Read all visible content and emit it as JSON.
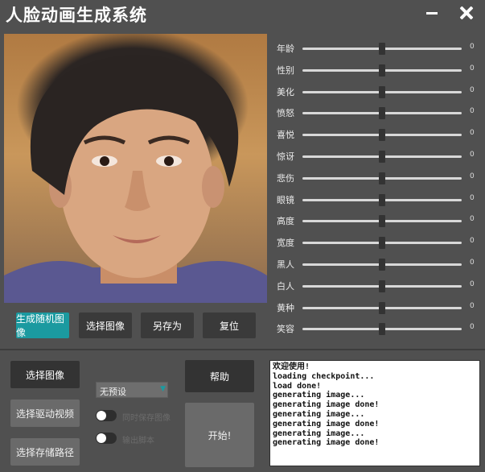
{
  "window": {
    "title": "人脸动画生成系统",
    "minimize_icon": "minimize-icon",
    "close_icon": "close-icon"
  },
  "preview": {
    "image": "generated-face-photo"
  },
  "buttons_row": {
    "random": "生成随机图像",
    "select_image": "选择图像",
    "save_as": "另存为",
    "reset": "复位"
  },
  "sliders": [
    {
      "label": "年龄",
      "value": "0",
      "level": 0.5
    },
    {
      "label": "性别",
      "value": "0",
      "level": 0.5
    },
    {
      "label": "美化",
      "value": "0",
      "level": 0.5
    },
    {
      "label": "愤怒",
      "value": "0",
      "level": 0.5
    },
    {
      "label": "喜悦",
      "value": "0",
      "level": 0.5
    },
    {
      "label": "惊讶",
      "value": "0",
      "level": 0.5
    },
    {
      "label": "悲伤",
      "value": "0",
      "level": 0.5
    },
    {
      "label": "眼镜",
      "value": "0",
      "level": 0.5
    },
    {
      "label": "高度",
      "value": "0",
      "level": 0.5
    },
    {
      "label": "宽度",
      "value": "0",
      "level": 0.5
    },
    {
      "label": "黑人",
      "value": "0",
      "level": 0.5
    },
    {
      "label": "白人",
      "value": "0",
      "level": 0.5
    },
    {
      "label": "黄种",
      "value": "0",
      "level": 0.5
    },
    {
      "label": "笑容",
      "value": "0",
      "level": 0.5
    }
  ],
  "bottom": {
    "select_image": "选择图像",
    "select_driving_video": "选择驱动视频",
    "select_save_path": "选择存储路径",
    "preset_select": "无预设",
    "toggle_save_image": "同时保存图像",
    "toggle_audio": "输出脚本",
    "help": "帮助",
    "start": "开始!"
  },
  "console_lines": [
    "欢迎使用!",
    "loading checkpoint...",
    "load done!",
    "generating image...",
    "generating image done!",
    "generating image...",
    "generating image done!",
    "generating image...",
    "generating image done!"
  ],
  "colors": {
    "background": "#505050",
    "accent": "#1b9aa0",
    "button": "#3a3a3a"
  }
}
